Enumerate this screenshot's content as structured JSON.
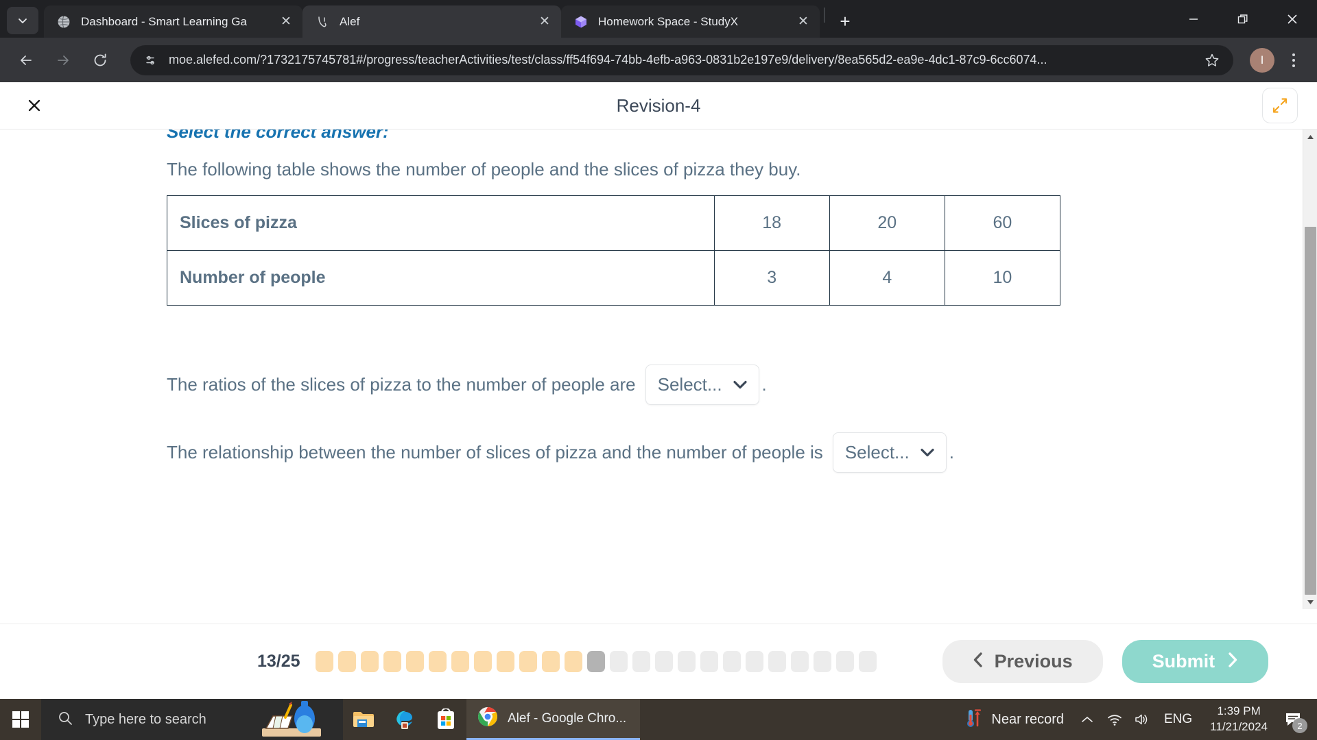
{
  "browser": {
    "tab_list_icon": "chevron-down-icon",
    "tabs": [
      {
        "title": "Dashboard - Smart Learning Ga",
        "favicon": "globe-icon",
        "active": false,
        "close_label": "✕"
      },
      {
        "title": "Alef",
        "favicon": "alef-icon",
        "active": true,
        "close_label": "✕"
      },
      {
        "title": "Homework Space - StudyX",
        "favicon": "studyx-icon",
        "active": false,
        "close_label": "✕"
      }
    ],
    "new_tab_label": "+",
    "window_controls": {
      "minimize": "–",
      "restore": "restore-icon",
      "close": "✕"
    },
    "nav": {
      "back": "←",
      "forward": "→",
      "reload": "↻"
    },
    "omnibox": {
      "site_settings_icon": "tune-icon",
      "url": "moe.alefed.com/?1732175745781#/progress/teacherActivities/test/class/ff54f694-74bb-4efb-a963-0831b2e197e9/delivery/8ea565d2-ea9e-4dc1-87c9-6cc6074...",
      "bookmark_icon": "star-icon"
    },
    "profile_initial": "I",
    "menu_icon": "kebab-menu-icon"
  },
  "app": {
    "header": {
      "close_label": "✕",
      "title": "Revision-4",
      "expand_icon": "expand-arrows-icon"
    },
    "question": {
      "instruction": "Select the correct answer:",
      "stem": "The following table shows the number of people and the slices of pizza they buy.",
      "table": {
        "rows": [
          {
            "label": "Slices of pizza",
            "values": [
              "18",
              "20",
              "60"
            ]
          },
          {
            "label": "Number of people",
            "values": [
              "3",
              "4",
              "10"
            ]
          }
        ]
      },
      "sentences": [
        {
          "before": "The ratios of the slices of pizza to the number of people are",
          "dropdown_value": "Select...",
          "after": "."
        },
        {
          "before": "The relationship between the number of slices of pizza and the number of people is",
          "dropdown_value": "Select...",
          "after": "."
        }
      ]
    },
    "footer": {
      "progress_label": "13/25",
      "total_steps": 25,
      "completed_steps": 12,
      "current_step": 13,
      "previous_label": "Previous",
      "previous_icon": "chevron-left-icon",
      "submit_label": "Submit",
      "submit_icon": "chevron-right-icon",
      "colors": {
        "done": "#fcdcab",
        "current": "#b3b3b3",
        "todo": "#ececec",
        "submit_bg": "#8ed8cd",
        "instruction": "#1773b0",
        "body_text": "#5a7184"
      }
    }
  },
  "taskbar": {
    "start_icon": "windows-start-icon",
    "search_placeholder": "Type here to search",
    "search_icon": "search-icon",
    "pinned": [
      {
        "name": "file-explorer-icon"
      },
      {
        "name": "microsoft-edge-icon"
      },
      {
        "name": "microsoft-store-icon"
      }
    ],
    "active_window": {
      "label": "Alef - Google Chro...",
      "icon": "chrome-icon"
    },
    "tray": {
      "weather_text": "Near record",
      "weather_icon": "thermometer-icon",
      "overflow_icon": "chevron-up-icon",
      "network_icon": "wifi-icon",
      "volume_icon": "speaker-icon",
      "language": "ENG",
      "time": "1:39 PM",
      "date": "11/21/2024",
      "notifications_icon": "chat-bubble-icon",
      "notifications_count": "2"
    }
  }
}
